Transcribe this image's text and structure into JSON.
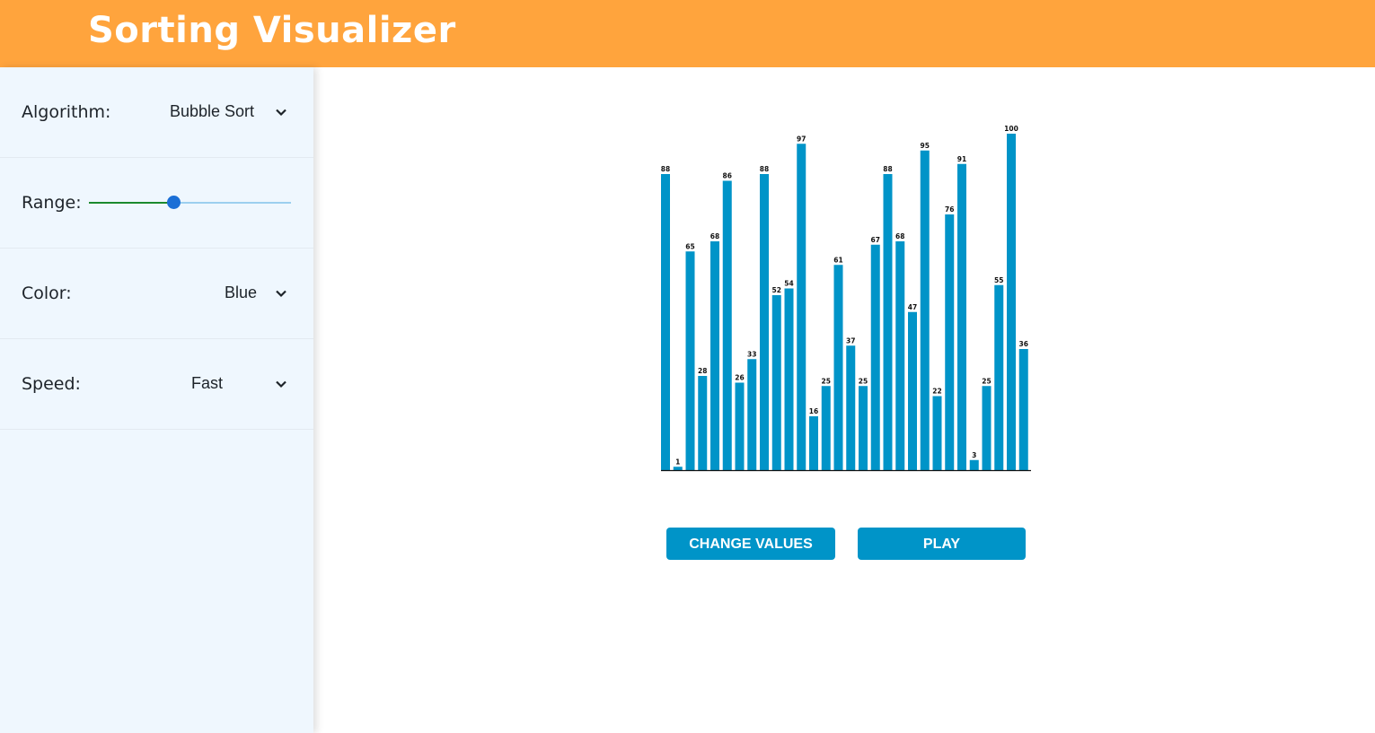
{
  "header": {
    "title": "Sorting Visualizer"
  },
  "sidebar": {
    "algorithm": {
      "label": "Algorithm:",
      "value": "Bubble Sort",
      "icon": "chevron-down-icon"
    },
    "range": {
      "label": "Range:",
      "level": 0.42
    },
    "color": {
      "label": "Color:",
      "value": "Blue",
      "icon": "chevron-down-icon"
    },
    "speed": {
      "label": "Speed:",
      "value": "Fast",
      "icon": "chevron-down-icon"
    }
  },
  "colors": {
    "header_bg": "#ffa43d",
    "sidebar_bg": "#eff7fe",
    "bar": "#0094c8",
    "button": "#0094c8",
    "slider_fill": "#1b8a2e",
    "slider_track": "#9ccfef",
    "slider_thumb": "#1b6fd6"
  },
  "chart_data": {
    "type": "bar",
    "values": [
      88,
      1,
      65,
      28,
      68,
      86,
      26,
      33,
      88,
      52,
      54,
      97,
      16,
      25,
      61,
      37,
      25,
      67,
      88,
      68,
      47,
      95,
      22,
      76,
      91,
      3,
      25,
      55,
      100,
      36
    ],
    "ylim": [
      0,
      100
    ],
    "show_value_labels": true,
    "grid": false
  },
  "buttons": {
    "change_values": "CHANGE VALUES",
    "play": "PLAY"
  }
}
